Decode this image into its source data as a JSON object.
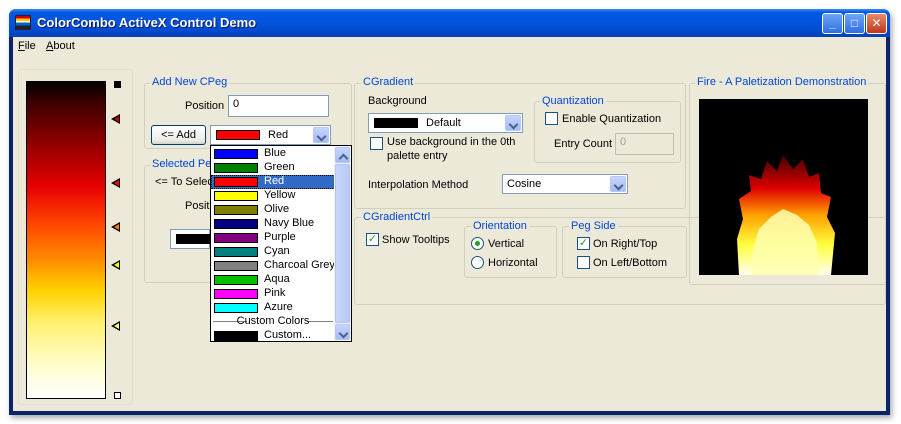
{
  "window": {
    "title": "ColorCombo ActiveX Control Demo"
  },
  "menu": [
    {
      "label_prefix": "F",
      "label_rest": "ile"
    },
    {
      "label_prefix": "A",
      "label_rest": "bout"
    }
  ],
  "add_peg": {
    "group_title": "Add New CPeg",
    "position_label": "Position",
    "position_value": "0",
    "add_button": "<= Add",
    "color_value": "Red",
    "color_hex": "#ff0000"
  },
  "selected_peg": {
    "group_title_partial": "Selected Pe",
    "select_label_partial": "<= To Selec",
    "position_label_partial": "Positi"
  },
  "color_dropdown": {
    "items": [
      {
        "label": "Blue",
        "color": "#0000ff"
      },
      {
        "label": "Green",
        "color": "#008000"
      },
      {
        "label": "Red",
        "color": "#ff0000",
        "selected": true
      },
      {
        "label": "Yellow",
        "color": "#ffff00"
      },
      {
        "label": "Olive",
        "color": "#808000"
      },
      {
        "label": "Navy Blue",
        "color": "#000080"
      },
      {
        "label": "Purple",
        "color": "#800080"
      },
      {
        "label": "Cyan",
        "color": "#008080"
      },
      {
        "label": "Charcoal Grey",
        "color": "#808080"
      },
      {
        "label": "Aqua",
        "color": "#00c000"
      },
      {
        "label": "Pink",
        "color": "#ff00ff"
      },
      {
        "label": "Azure",
        "color": "#00ffff"
      }
    ],
    "custom_header": "Custom Colors",
    "custom_item": {
      "label": "Custom...",
      "color": "#000000"
    }
  },
  "cgradient": {
    "group_title": "CGradient",
    "background_label": "Background",
    "background_value": "Default",
    "background_color": "#000000",
    "use_bg_label_line1": "Use background in the 0th",
    "use_bg_label_line2": "palette entry",
    "interp_label": "Interpolation Method",
    "interp_value": "Cosine",
    "quantization": {
      "group_title": "Quantization",
      "enable_label": "Enable Quantization",
      "entry_count_label": "Entry Count",
      "entry_count_value": "0"
    }
  },
  "cgradientctrl": {
    "group_title": "CGradientCtrl",
    "show_tooltips_label": "Show Tooltips",
    "show_tooltips_checked": true,
    "orientation": {
      "group_title": "Orientation",
      "vertical_label": "Vertical",
      "horizontal_label": "Horizontal",
      "selected": "Vertical"
    },
    "peg_side": {
      "group_title": "Peg Side",
      "right_top_label": "On Right/Top",
      "right_top_checked": true,
      "left_bottom_label": "On Left/Bottom",
      "left_bottom_checked": false
    }
  },
  "fire": {
    "group_title": "Fire - A Paletization Demonstration"
  },
  "gradient_pegs": [
    {
      "pos": 0.12,
      "color": "#c00000"
    },
    {
      "pos": 0.32,
      "color": "#ff0000"
    },
    {
      "pos": 0.46,
      "color": "#ff8000"
    },
    {
      "pos": 0.58,
      "color": "#ffff00"
    },
    {
      "pos": 0.77,
      "color": "#ffff80"
    }
  ],
  "colors": {
    "title_bar": "#0058e6",
    "client_bg": "#ece9d8",
    "group_title": "#0046d5",
    "selection": "#316ac5"
  }
}
